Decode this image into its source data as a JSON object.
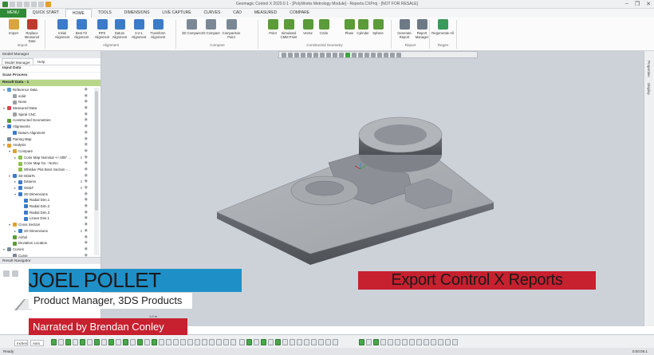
{
  "app": {
    "title": "Geomagic Control X 2020.0.1 - [PolyWorks Metrology Module] - Reports.CXProj - [NOT FOR RESALE]"
  },
  "window_controls": [
    "–",
    "❐",
    "✕"
  ],
  "ribbon_tabs": [
    "MENU",
    "QUICK START",
    "HOME",
    "TOOLS",
    "DIMENSIONS",
    "LIVE CAPTURE",
    "CURVES",
    "CAD",
    "MEASURED",
    "COMPARE"
  ],
  "ribbon": {
    "buttons": [
      {
        "label": "Import",
        "color": "#d9a441"
      },
      {
        "label": "Replace Measured Data",
        "color": "#c0392b"
      },
      {
        "label": "Initial Alignment",
        "color": "#3b7bc8"
      },
      {
        "label": "Best Fit Alignment",
        "color": "#3b7bc8"
      },
      {
        "label": "RPS Alignment",
        "color": "#3b7bc8"
      },
      {
        "label": "Datum Alignment",
        "color": "#3b7bc8"
      },
      {
        "label": "3-2-1 Alignment",
        "color": "#3b7bc8"
      },
      {
        "label": "Transform Alignment",
        "color": "#3b7bc8"
      },
      {
        "label": "3D Compare",
        "color": "#7a8895"
      },
      {
        "label": "2D Compare",
        "color": "#7a8895"
      },
      {
        "label": "Comparison Point",
        "color": "#7a8895"
      },
      {
        "label": "Point",
        "color": "#5b9b3a"
      },
      {
        "label": "Simulated CMM Point",
        "color": "#5b9b3a"
      },
      {
        "label": "Vector",
        "color": "#5b9b3a"
      },
      {
        "label": "Circle",
        "color": "#5b9b3a"
      },
      {
        "label": "Plane",
        "color": "#5b9b3a"
      },
      {
        "label": "Cylinder",
        "color": "#5b9b3a"
      },
      {
        "label": "Sphere",
        "color": "#5b9b3a"
      },
      {
        "label": "Generate Report",
        "color": "#6d7a86"
      },
      {
        "label": "Report Manager",
        "color": "#6d7a86"
      },
      {
        "label": "Regenerate All",
        "color": "#3a9a5b"
      }
    ],
    "groups": [
      "Import",
      "Alignment",
      "Compare",
      "Constructed Geometry",
      "Report",
      "Regen"
    ]
  },
  "left_panel": {
    "header": "Model Manager",
    "tabs": [
      "Model Manager",
      "Help"
    ],
    "input_data": "Input Data",
    "scan_process": "Scan Process",
    "result_data": "Result Data - 1",
    "tree": [
      {
        "level": 0,
        "arrow": "▾",
        "label": "Reference Data",
        "color": "#5a9ad6"
      },
      {
        "level": 1,
        "arrow": "",
        "label": "solid",
        "color": "#9aa0a7"
      },
      {
        "level": 1,
        "arrow": "",
        "label": "None",
        "color": "#9aa0a7"
      },
      {
        "level": 0,
        "arrow": "▾",
        "label": "Measured Data",
        "color": "#d1474f"
      },
      {
        "level": 1,
        "arrow": "",
        "label": "Spiral CNC",
        "color": "#9aa0a7"
      },
      {
        "level": 0,
        "arrow": "",
        "label": "Constructed Geometries",
        "color": "#5b9b3a"
      },
      {
        "level": 0,
        "arrow": "▾",
        "label": "Alignments",
        "color": "#3b7bc8"
      },
      {
        "level": 1,
        "arrow": "",
        "label": "Datum Alignment",
        "color": "#3b7bc8"
      },
      {
        "level": 0,
        "arrow": "",
        "label": "Pairing Map",
        "color": "#7a8895"
      },
      {
        "level": 0,
        "arrow": "▾",
        "label": "Analysis",
        "color": "#e0a030"
      },
      {
        "level": 1,
        "arrow": "▾",
        "label": "Compare",
        "color": "#e0a030"
      },
      {
        "level": 2,
        "arrow": "▸",
        "label": "Color Map Nominal +/-.005\" ...",
        "color": "#8cc04a",
        "num": "2"
      },
      {
        "level": 2,
        "arrow": "",
        "label": "Color Map Go - NoGo",
        "color": "#8cc04a"
      },
      {
        "level": 2,
        "arrow": "",
        "label": "Whisker Plot Boss Section -...",
        "color": "#8cc04a"
      },
      {
        "level": 1,
        "arrow": "▾",
        "label": "3D GD&Ts",
        "color": "#3b7bc8"
      },
      {
        "level": 2,
        "arrow": "▸",
        "label": "Datums",
        "color": "#3b7bc8",
        "num": "3"
      },
      {
        "level": 2,
        "arrow": "▸",
        "label": "GD&T",
        "color": "#3b7bc8",
        "num": "3"
      },
      {
        "level": 2,
        "arrow": "▾",
        "label": "3D Dimensions",
        "color": "#3b7bc8"
      },
      {
        "level": 3,
        "arrow": "",
        "label": "Radial Dim.1",
        "color": "#3b7bc8"
      },
      {
        "level": 3,
        "arrow": "",
        "label": "Radial Dim.2",
        "color": "#3b7bc8"
      },
      {
        "level": 3,
        "arrow": "",
        "label": "Radial Dim.3",
        "color": "#3b7bc8"
      },
      {
        "level": 3,
        "arrow": "",
        "label": "Linear Dim.1",
        "color": "#3b7bc8"
      },
      {
        "level": 1,
        "arrow": "▾",
        "label": "Cross Section",
        "color": "#e0a030"
      },
      {
        "level": 2,
        "arrow": "▸",
        "label": "2D Dimensions",
        "color": "#3b7bc8",
        "num": "3"
      },
      {
        "level": 1,
        "arrow": "",
        "label": "Airfoil",
        "color": "#5b9b3a"
      },
      {
        "level": 1,
        "arrow": "",
        "label": "Deviation Location",
        "color": "#5b9b3a"
      },
      {
        "level": 0,
        "arrow": "▾",
        "label": "Curves",
        "color": "#7a8895"
      },
      {
        "level": 1,
        "arrow": "",
        "label": "Curve",
        "color": "#7a8895"
      }
    ],
    "result_navigator": "Result Navigator"
  },
  "viewport": {
    "background": "#cdd2d8",
    "scale_label": "1.0 in"
  },
  "right_strip": {
    "labels": [
      "Properties",
      "Display"
    ]
  },
  "bottom": {
    "select_a": "Inches",
    "select_b": "Auto"
  },
  "status": {
    "left": "Ready",
    "right": "0:00:06.1"
  },
  "overlays": {
    "name": "JOEL POLLET",
    "job_title": "Product Manager, 3DS Products",
    "narrator": "Narrated by Brendan Conley",
    "topic": "Export Control X Reports",
    "accent_blue": "#1f8fc7",
    "accent_red": "#c7202f"
  }
}
